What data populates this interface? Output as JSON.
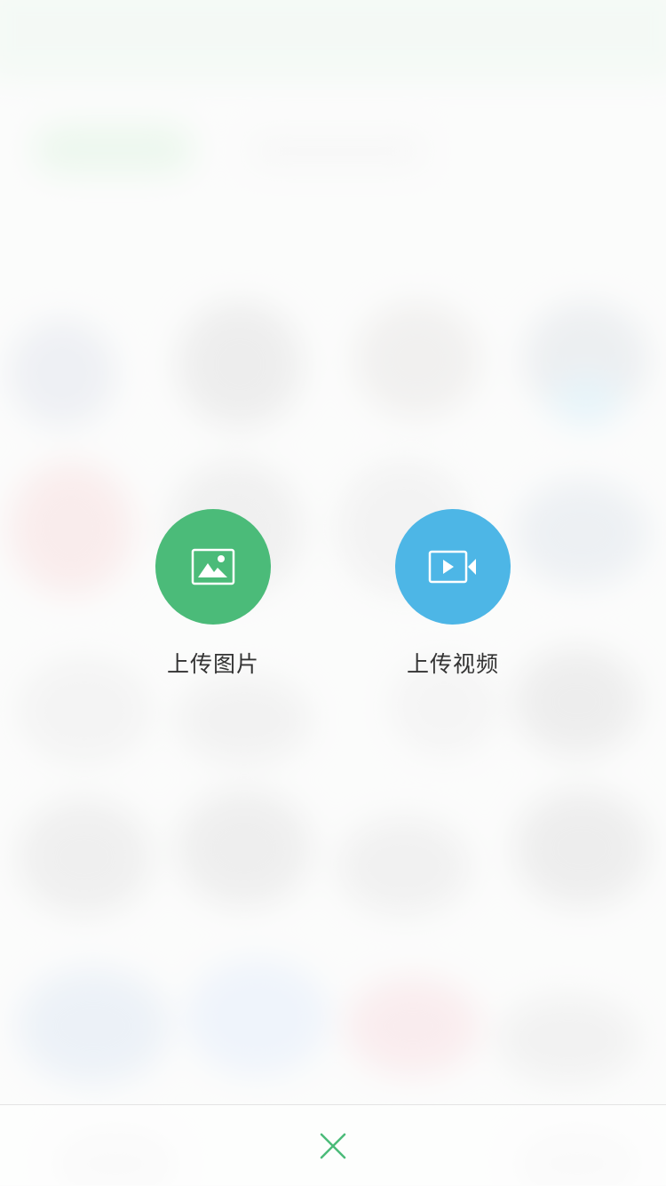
{
  "actions": {
    "upload_image": {
      "label": "上传图片",
      "icon": "image-icon",
      "color": "#4bbb79"
    },
    "upload_video": {
      "label": "上传视频",
      "icon": "video-camera-icon",
      "color": "#4db6e6"
    }
  },
  "close": {
    "icon": "close-icon",
    "color": "#4bbb79"
  }
}
